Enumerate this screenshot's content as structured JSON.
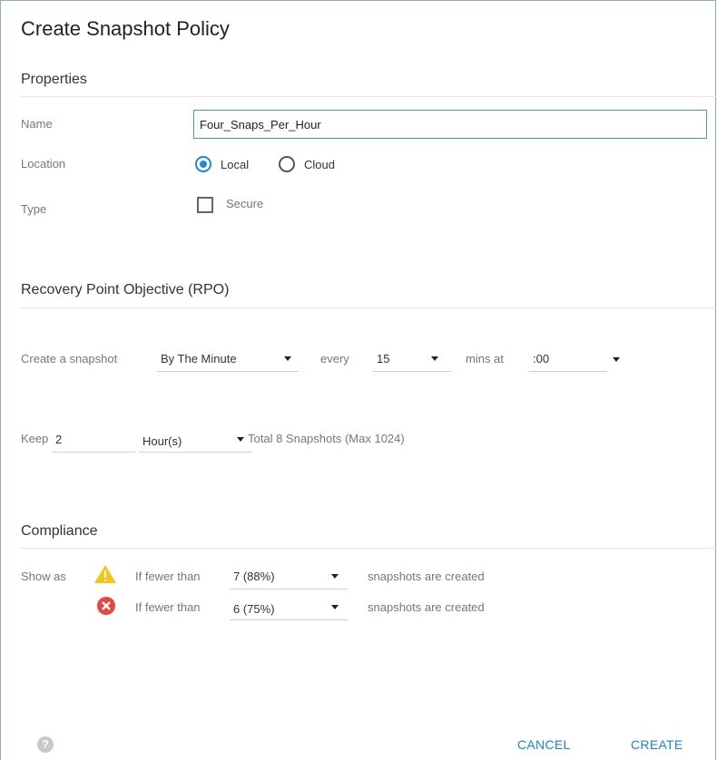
{
  "dialog": {
    "title": "Create Snapshot Policy"
  },
  "properties": {
    "heading": "Properties",
    "name_label": "Name",
    "name_value": "Four_Snaps_Per_Hour",
    "location_label": "Location",
    "location_options": [
      {
        "label": "Local",
        "selected": true
      },
      {
        "label": "Cloud",
        "selected": false
      }
    ],
    "type_label": "Type",
    "secure_label": "Secure",
    "secure_checked": false
  },
  "rpo": {
    "heading": "Recovery Point Objective (RPO)",
    "create_label": "Create a snapshot",
    "frequency_value": "By The Minute",
    "every_label": "every",
    "interval_value": "15",
    "mins_at_label": "mins at",
    "at_value": ":00",
    "keep_label": "Keep",
    "keep_value": "2",
    "keep_unit": "Hour(s)",
    "total_text": "Total 8 Snapshots (Max 1024)"
  },
  "compliance": {
    "heading": "Compliance",
    "show_as_label": "Show as",
    "rows": [
      {
        "icon": "warning-icon",
        "prefix": "If fewer than",
        "value": "7 (88%)",
        "suffix": "snapshots are created"
      },
      {
        "icon": "error-icon",
        "prefix": "If fewer than",
        "value": "6 (75%)",
        "suffix": "snapshots are created"
      }
    ]
  },
  "footer": {
    "help_glyph": "?",
    "cancel_label": "CANCEL",
    "create_label": "CREATE"
  },
  "colors": {
    "accent": "#1a86c7",
    "warning": "#f5c518",
    "error": "#e8473d"
  }
}
